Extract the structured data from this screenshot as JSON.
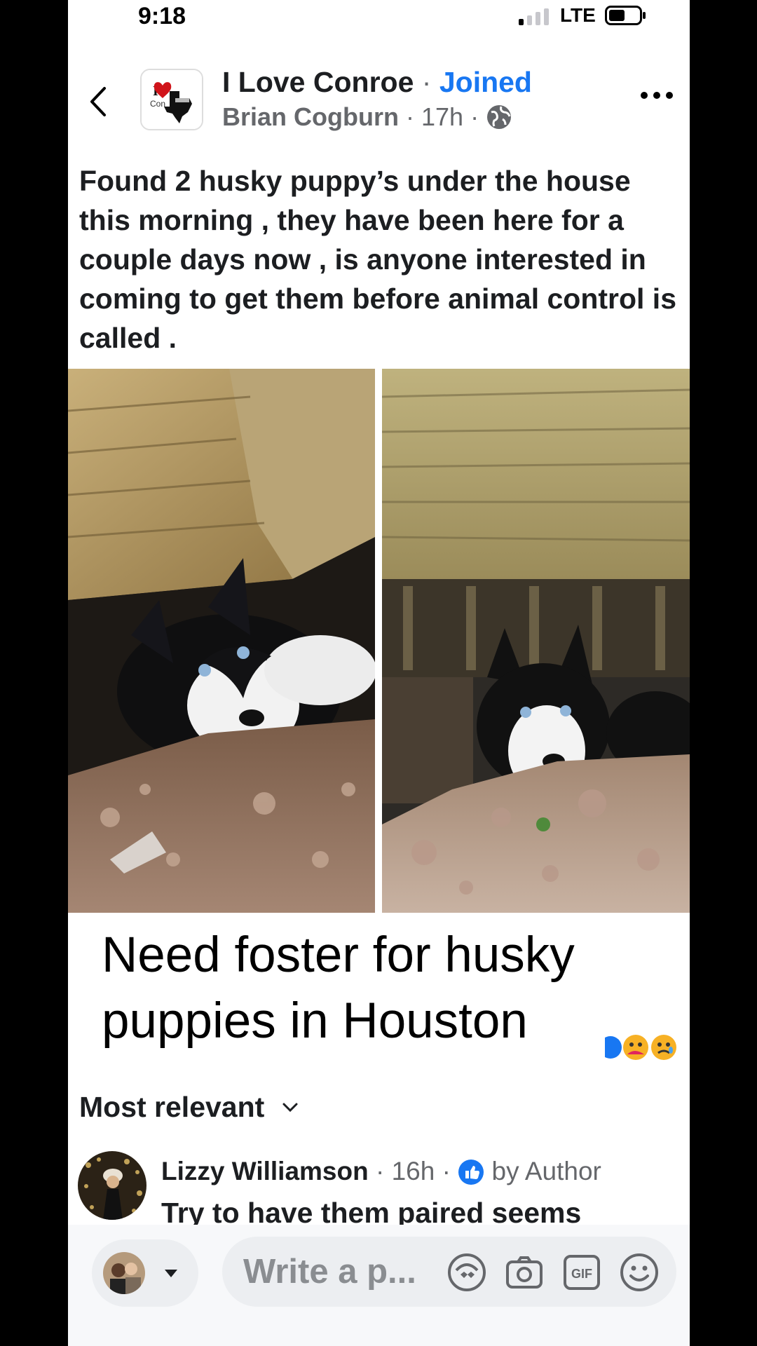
{
  "status": {
    "time": "9:18",
    "network": "LTE"
  },
  "header": {
    "group_name": "I Love Conroe",
    "separator": "·",
    "joined_label": "Joined",
    "author": "Brian Cogburn",
    "time_ago": "17h",
    "audience_icon": "globe-icon"
  },
  "post": {
    "text": "Found 2 husky puppy’s under the house this morning , they have been here for a couple days now , is anyone interested in coming to get them before animal control is called ."
  },
  "caption": {
    "line1": "Need foster for husky",
    "line2": "puppies in Houston"
  },
  "comments": {
    "sort_label": "Most relevant",
    "first": {
      "name": "Lizzy Williamson",
      "time_ago": "16h",
      "badge": "by Author",
      "text": "Try to have them paired seems"
    }
  },
  "composer": {
    "placeholder": "Write a p..."
  },
  "colors": {
    "accent": "#1877f2",
    "text": "#1c1e21",
    "muted": "#65676b"
  }
}
